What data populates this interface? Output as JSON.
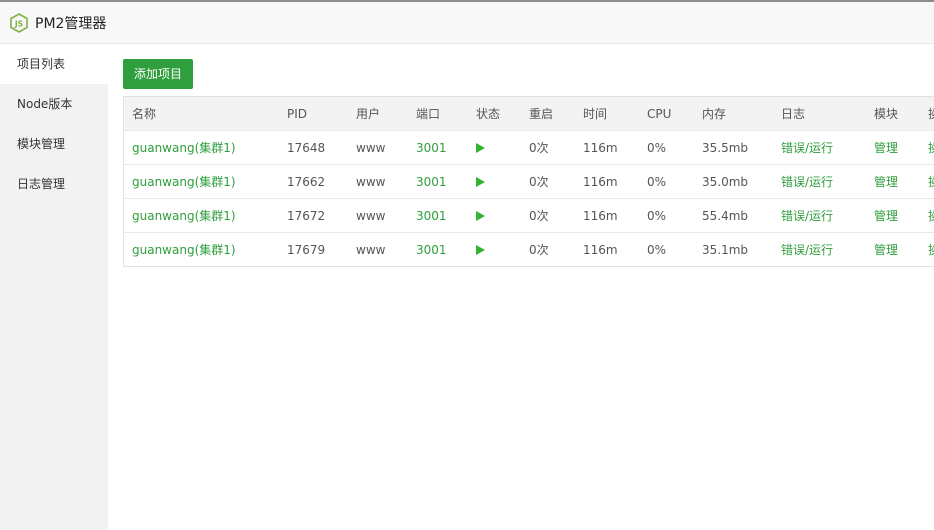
{
  "app": {
    "title": "PM2管理器",
    "logo_icon": "nodejs-hexagon-icon",
    "accent": "#2f9e3c"
  },
  "sidebar": {
    "items": [
      {
        "label": "项目列表",
        "active": true
      },
      {
        "label": "Node版本",
        "active": false
      },
      {
        "label": "模块管理",
        "active": false
      },
      {
        "label": "日志管理",
        "active": false
      }
    ]
  },
  "toolbar": {
    "add_label": "添加项目"
  },
  "table": {
    "headers": [
      "名称",
      "PID",
      "用户",
      "端口",
      "状态",
      "重启",
      "时间",
      "CPU",
      "内存",
      "日志",
      "模块",
      "操"
    ],
    "rows": [
      {
        "name": "guanwang(集群1)",
        "pid": "17648",
        "user": "www",
        "port": "3001",
        "status": "running",
        "restart": "0次",
        "time": "116m",
        "cpu": "0%",
        "mem": "35.5mb",
        "log": "错误/运行",
        "module": "管理",
        "op": "操"
      },
      {
        "name": "guanwang(集群1)",
        "pid": "17662",
        "user": "www",
        "port": "3001",
        "status": "running",
        "restart": "0次",
        "time": "116m",
        "cpu": "0%",
        "mem": "35.0mb",
        "log": "错误/运行",
        "module": "管理",
        "op": "操"
      },
      {
        "name": "guanwang(集群1)",
        "pid": "17672",
        "user": "www",
        "port": "3001",
        "status": "running",
        "restart": "0次",
        "time": "116m",
        "cpu": "0%",
        "mem": "55.4mb",
        "log": "错误/运行",
        "module": "管理",
        "op": "操"
      },
      {
        "name": "guanwang(集群1)",
        "pid": "17679",
        "user": "www",
        "port": "3001",
        "status": "running",
        "restart": "0次",
        "time": "116m",
        "cpu": "0%",
        "mem": "35.1mb",
        "log": "错误/运行",
        "module": "管理",
        "op": "操"
      }
    ]
  }
}
